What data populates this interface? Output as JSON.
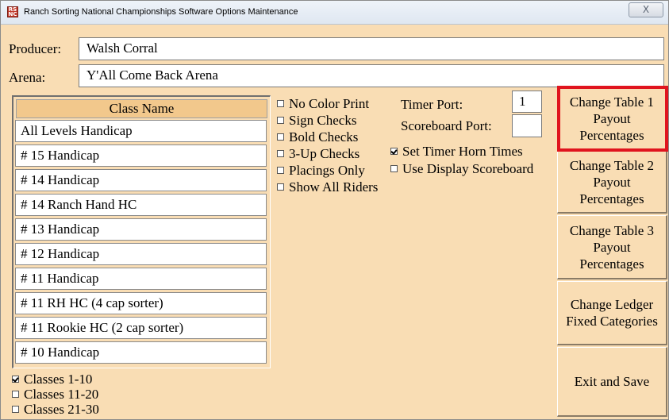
{
  "window": {
    "title": "Ranch Sorting National Championships Software Options Maintenance",
    "icon_text": [
      "RS",
      "NC"
    ],
    "close_glyph": "X"
  },
  "producer": {
    "label": "Producer:",
    "value": "Walsh Corral"
  },
  "arena": {
    "label": "Arena:",
    "value": "Y'All Come Back Arena"
  },
  "class_list": {
    "header": "Class Name",
    "rows": [
      "All Levels Handicap",
      "# 15 Handicap",
      "# 14 Handicap",
      "# 14 Ranch Hand HC",
      "# 13 Handicap",
      "# 12 Handicap",
      "# 11 Handicap",
      "# 11 RH HC (4 cap sorter)",
      "# 11 Rookie HC (2 cap sorter)",
      "# 10 Handicap"
    ]
  },
  "class_ranges": [
    {
      "label": "Classes 1-10",
      "checked": true
    },
    {
      "label": "Classes 11-20",
      "checked": false
    },
    {
      "label": "Classes 21-30",
      "checked": false
    }
  ],
  "print_options": [
    {
      "label": "No Color Print",
      "checked": false
    },
    {
      "label": "Sign Checks",
      "checked": false
    },
    {
      "label": "Bold Checks",
      "checked": false
    },
    {
      "label": "3-Up Checks",
      "checked": false
    },
    {
      "label": "Placings Only",
      "checked": false
    },
    {
      "label": "Show All Riders",
      "checked": false
    }
  ],
  "timer": {
    "timer_port_label": "Timer Port:",
    "timer_port_value": "1",
    "scoreboard_port_label": "Scoreboard Port:",
    "scoreboard_port_value": "",
    "set_horn_label": "Set Timer Horn Times",
    "set_horn_checked": true,
    "display_scoreboard_label": "Use Display Scoreboard",
    "display_scoreboard_checked": false
  },
  "buttons": {
    "table1": [
      "Change Table 1",
      "Payout",
      "Percentages"
    ],
    "table2": [
      "Change Table 2",
      "Payout",
      "Percentages"
    ],
    "table3": [
      "Change Table 3",
      "Payout",
      "Percentages"
    ],
    "ledger": [
      "Change Ledger",
      "Fixed Categories"
    ],
    "exit": [
      "Exit and Save"
    ]
  },
  "colors": {
    "background": "#f9ddb4",
    "header": "#f2c88c",
    "highlight": "#e0141e"
  }
}
